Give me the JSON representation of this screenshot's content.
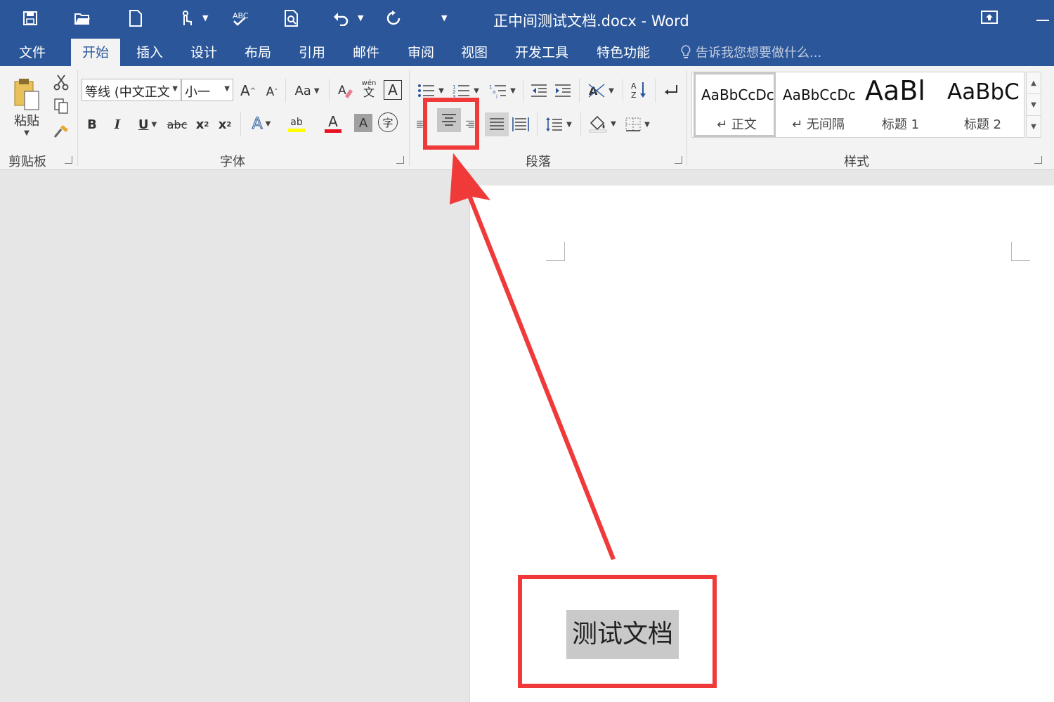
{
  "window": {
    "title": "正中间测试文档.docx - Word"
  },
  "quick_access": {
    "icons": [
      "save-icon",
      "open-icon",
      "new-icon",
      "touch-mode-icon",
      "spelling-icon",
      "print-preview-icon",
      "undo-icon",
      "redo-icon",
      "customize-icon"
    ]
  },
  "tabs": [
    {
      "label": "文件",
      "active": false
    },
    {
      "label": "开始",
      "active": true
    },
    {
      "label": "插入",
      "active": false
    },
    {
      "label": "设计",
      "active": false
    },
    {
      "label": "布局",
      "active": false
    },
    {
      "label": "引用",
      "active": false
    },
    {
      "label": "邮件",
      "active": false
    },
    {
      "label": "审阅",
      "active": false
    },
    {
      "label": "视图",
      "active": false
    },
    {
      "label": "开发工具",
      "active": false
    },
    {
      "label": "特色功能",
      "active": false
    }
  ],
  "tell_me": {
    "placeholder": "告诉我您想要做什么..."
  },
  "clipboard": {
    "paste_label": "粘贴",
    "group_label": "剪贴板"
  },
  "font": {
    "font_name": "等线 (中文正文",
    "font_size": "小一",
    "grow_label": "A",
    "shrink_label": "A",
    "case_label": "Aa",
    "phonetic_label": "wén",
    "phonetic_char": "文",
    "border_label": "A",
    "bold_label": "B",
    "italic_label": "I",
    "underline_label": "U",
    "strike_label": "abc",
    "subscript_label": "x",
    "superscript_label": "x",
    "highlight_label": "ab",
    "color_label": "A",
    "shading_label": "A",
    "enclose_label": "字",
    "group_label": "字体"
  },
  "paragraph": {
    "group_label": "段落"
  },
  "styles": {
    "items": [
      {
        "sample": "AaBbCcDc",
        "name": "↵ 正文"
      },
      {
        "sample": "AaBbCcDc",
        "name": "↵ 无间隔"
      },
      {
        "sample": "AaBl",
        "name": "标题 1"
      },
      {
        "sample": "AaBbC",
        "name": "标题 2"
      }
    ],
    "group_label": "样式"
  },
  "document": {
    "text": "测试文档"
  },
  "colors": {
    "accent": "#2b579a",
    "annotation": "#f03a3a",
    "highlight_yellow": "#ffff00",
    "font_red": "#e81123"
  }
}
